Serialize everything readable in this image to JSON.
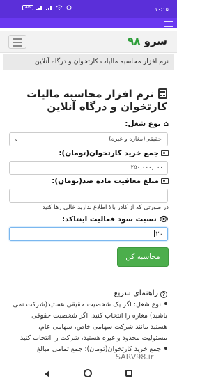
{
  "status_bar": {
    "time": "۱۰:۱۵",
    "battery": "46"
  },
  "header": {
    "brand_name": "سرو",
    "brand_number": "۹۸",
    "subtitle": "نرم افزار محاسبه مالیات کارتخوان و درگاه آنلاین"
  },
  "form": {
    "title": "نرم افزار محاسبه مالیات کارتخوان و درگاه آنلاین",
    "job_type_label": "نوع شغل:",
    "job_type_value": "حقیقی(مغازه و غیره)",
    "purchase_total_label": "جمع خرید کارتخوان(تومان):",
    "purchase_total_value": "۲۵۰,۰۰۰,۰۰۰",
    "exemption_label": "مبلغ معافیت ماده صد(تومان):",
    "exemption_value": "",
    "exemption_hint": "در صورتی که از کادر بالا اطلاع ندارید خالی رها کنید",
    "profit_ratio_label": "نسبت سود فعالیت اینتاکد:",
    "profit_ratio_value": "۲۰",
    "calculate_label": "محاسبه کن"
  },
  "guide": {
    "title": "راهنمای سریع",
    "item_1": "نوع شغل: اگر یک شخصیت حقیقی هستید(شرکت نمی باشید) مغازه را انتخاب کنید. اگر شخصیت حقوقی هستید مانند شرکت سهامی خاص، سهامی عام، مسئولیت محدود و غیره هستید، شرکت را انتخاب کنید",
    "item_2_partial": "جمع خرید کارتخوان(تومان): جمع تمامی مبالغ"
  },
  "watermark": "SARV98.ir",
  "colors": {
    "status_bar": "#5b2fd9",
    "accent_purple": "#6a38f0",
    "brand_green": "#2e9e3a",
    "button_green": "#4cae4c"
  }
}
